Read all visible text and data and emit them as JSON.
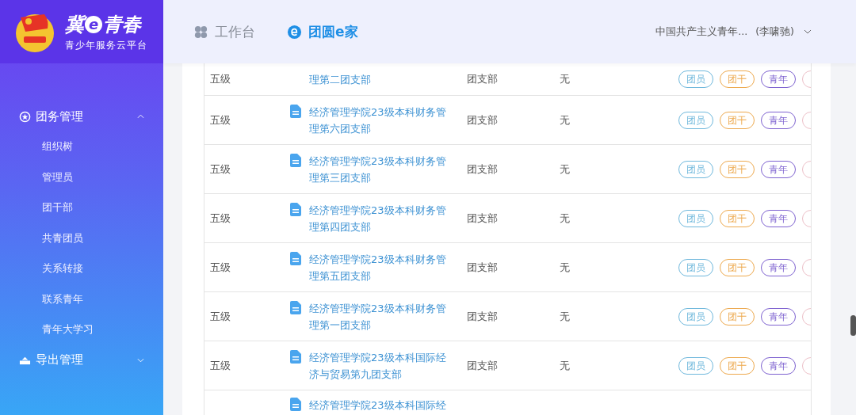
{
  "logo": {
    "title": [
      "冀",
      "e",
      "青春"
    ],
    "subtitle": "青少年服务云平台"
  },
  "nav": [
    {
      "label": "工作台",
      "selected": false,
      "kind": "workbench"
    },
    {
      "label": "团圆e家",
      "selected": true,
      "kind": "family"
    }
  ],
  "user": {
    "org": "中国共产主义青年...",
    "name": "(李啸驰)"
  },
  "sidebar": [
    {
      "label": "团务管理",
      "kind": "star",
      "expanded": true,
      "children": [
        {
          "label": "组织树"
        },
        {
          "label": "管理员"
        },
        {
          "label": "团干部"
        },
        {
          "label": "共青团员"
        },
        {
          "label": "关系转接"
        },
        {
          "label": "联系青年"
        },
        {
          "label": "青年大学习"
        }
      ]
    },
    {
      "label": "导出管理",
      "kind": "export",
      "expanded": false
    }
  ],
  "rows": [
    {
      "kind": "top-cut",
      "level": "五级",
      "name": "理第二团支部",
      "type": "团支部",
      "extra": "无",
      "tags": [
        {
          "label": "团员",
          "color": "#6fb8dc"
        },
        {
          "label": "团干",
          "color": "#eda94e"
        },
        {
          "label": "青年",
          "color": "#7e62d0"
        }
      ]
    },
    {
      "kind": "full",
      "level": "五级",
      "name": "经济管理学院23级本科财务管理第六团支部",
      "type": "团支部",
      "extra": "无",
      "tags": [
        {
          "label": "团员",
          "color": "#6fb8dc"
        },
        {
          "label": "团干",
          "color": "#eda94e"
        },
        {
          "label": "青年",
          "color": "#7e62d0"
        }
      ]
    },
    {
      "kind": "full",
      "level": "五级",
      "name": "经济管理学院23级本科财务管理第三团支部",
      "type": "团支部",
      "extra": "无",
      "tags": [
        {
          "label": "团员",
          "color": "#6fb8dc"
        },
        {
          "label": "团干",
          "color": "#eda94e"
        },
        {
          "label": "青年",
          "color": "#7e62d0"
        }
      ]
    },
    {
      "kind": "full",
      "level": "五级",
      "name": "经济管理学院23级本科财务管理第四团支部",
      "type": "团支部",
      "extra": "无",
      "tags": [
        {
          "label": "团员",
          "color": "#6fb8dc"
        },
        {
          "label": "团干",
          "color": "#eda94e"
        },
        {
          "label": "青年",
          "color": "#7e62d0"
        }
      ]
    },
    {
      "kind": "full",
      "level": "五级",
      "name": "经济管理学院23级本科财务管理第五团支部",
      "type": "团支部",
      "extra": "无",
      "tags": [
        {
          "label": "团员",
          "color": "#6fb8dc"
        },
        {
          "label": "团干",
          "color": "#eda94e"
        },
        {
          "label": "青年",
          "color": "#7e62d0"
        }
      ]
    },
    {
      "kind": "full",
      "level": "五级",
      "name": "经济管理学院23级本科财务管理第一团支部",
      "type": "团支部",
      "extra": "无",
      "tags": [
        {
          "label": "团员",
          "color": "#6fb8dc"
        },
        {
          "label": "团干",
          "color": "#eda94e"
        },
        {
          "label": "青年",
          "color": "#7e62d0"
        }
      ]
    },
    {
      "kind": "full",
      "level": "五级",
      "name": "经济管理学院23级本科国际经济与贸易第九团支部",
      "type": "团支部",
      "extra": "无",
      "tags": [
        {
          "label": "团员",
          "color": "#6fb8dc"
        },
        {
          "label": "团干",
          "color": "#eda94e"
        },
        {
          "label": "青年",
          "color": "#7e62d0"
        }
      ]
    },
    {
      "kind": "bottom-cut",
      "name": "经济管理学院23级本科国际经"
    }
  ]
}
